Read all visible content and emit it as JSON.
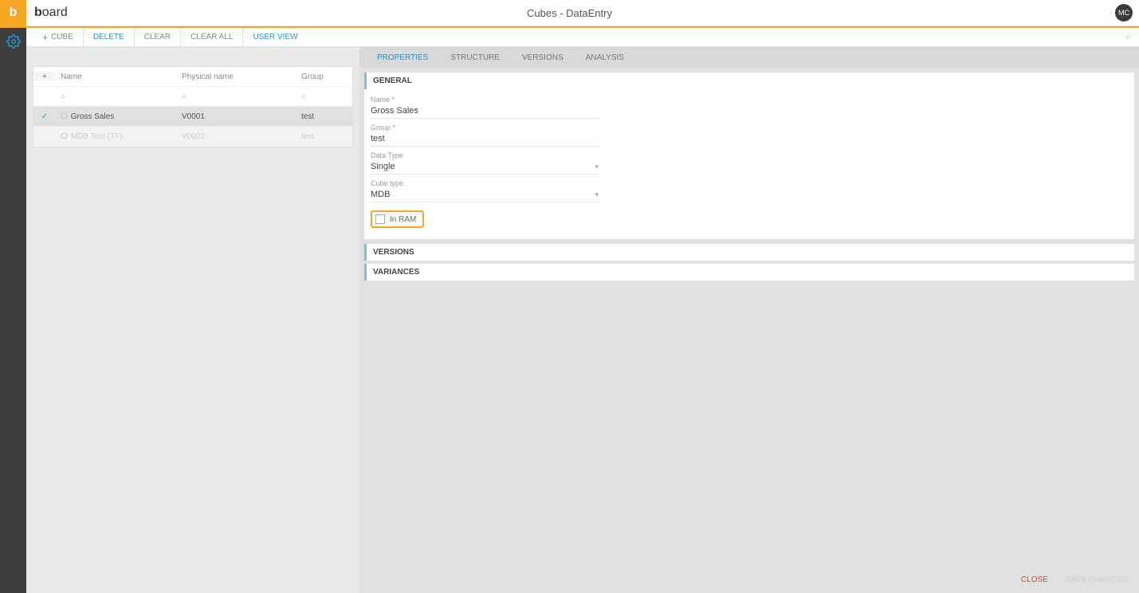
{
  "header": {
    "logo_html": "board",
    "title": "Cubes - DataEntry",
    "avatar": "MC"
  },
  "toolbar": {
    "cube": "CUBE",
    "delete": "DELETE",
    "clear": "CLEAR",
    "clear_all": "CLEAR ALL",
    "user_view": "USER VIEW"
  },
  "list": {
    "headers": {
      "name": "Name",
      "physical": "Physical name",
      "group": "Group"
    },
    "rows": [
      {
        "name": "Gross Sales",
        "physical": "V0001",
        "group": "test",
        "selected": true
      },
      {
        "name": "MDB Test (TF)",
        "physical": "V0002",
        "group": "test",
        "faded": true
      }
    ]
  },
  "tabs": {
    "properties": "PROPERTIES",
    "structure": "STRUCTURE",
    "versions": "VERSIONS",
    "analysis": "ANALYSIS"
  },
  "sections": {
    "general": "GENERAL",
    "versions": "VERSIONS",
    "variances": "VARIANCES"
  },
  "form": {
    "name_label": "Name *",
    "name_value": "Gross Sales",
    "group_label": "Group *",
    "group_value": "test",
    "datatype_label": "Data Type",
    "datatype_value": "Single",
    "cubetype_label": "Cube type",
    "cubetype_value": "MDB",
    "inram_label": "In RAM"
  },
  "footer": {
    "close": "CLOSE",
    "save": "SAVE CHANGES"
  }
}
